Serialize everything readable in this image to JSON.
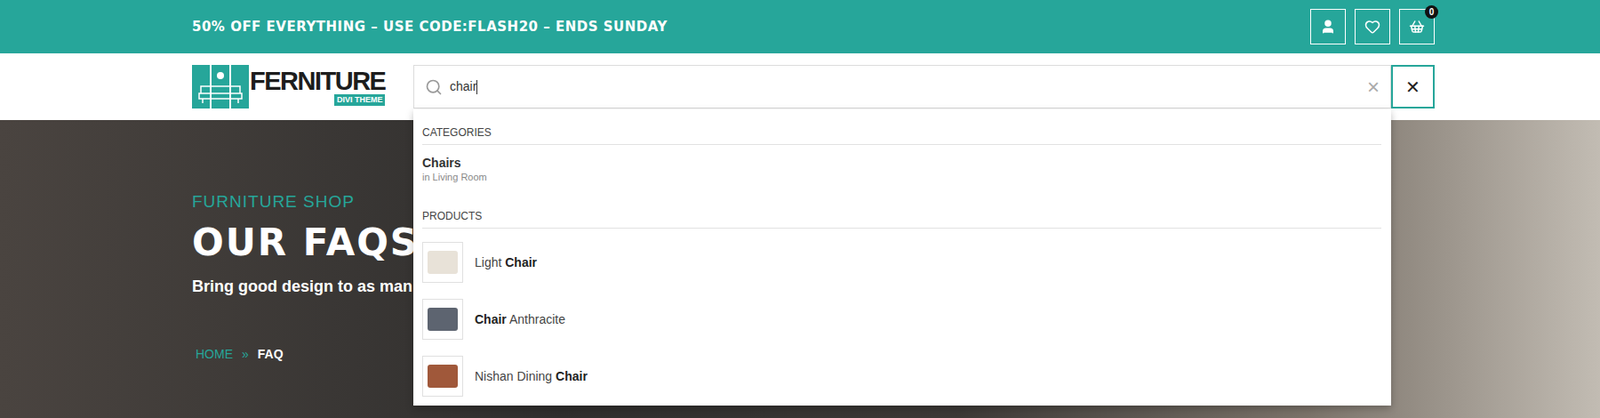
{
  "promo": {
    "text": "50% OFF EVERYTHING – USE CODE:FLASH20 – ENDS SUNDAY"
  },
  "header_icons": {
    "cart_count": "0"
  },
  "logo": {
    "name": "FERNITURE",
    "tagline": "DIVI THEME"
  },
  "search": {
    "value": "chair",
    "clear": "×",
    "close": "✕"
  },
  "categories": {
    "title": "CATEGORIES",
    "items": [
      {
        "name": "Chairs",
        "parent": "in Living Room"
      }
    ]
  },
  "products": {
    "title": "PRODUCTS",
    "items": [
      {
        "name": [
          {
            "text": "Light ",
            "match": false
          },
          {
            "text": "Chair",
            "match": true
          }
        ],
        "thumb": "#e8e2d8"
      },
      {
        "name": [
          {
            "text": "Chair",
            "match": true
          },
          {
            "text": " Anthracite",
            "match": false
          }
        ],
        "thumb": "#5d6470"
      },
      {
        "name": [
          {
            "text": "Nishan Dining ",
            "match": false
          },
          {
            "text": "Chair",
            "match": true
          }
        ],
        "thumb": "#a0583a"
      }
    ]
  },
  "hero": {
    "eyebrow": "FURNITURE SHOP",
    "title": "OUR FAQS",
    "subtitle": "Bring good design to as man",
    "separator": "»",
    "breadcrumb": [
      {
        "label": "HOME",
        "current": false
      },
      {
        "label": "FAQ",
        "current": true
      }
    ]
  }
}
